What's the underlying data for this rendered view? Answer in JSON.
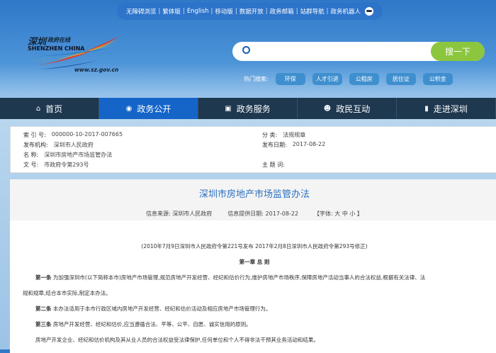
{
  "topbar": {
    "links": [
      "无障碍浏览",
      "繁体版",
      "English",
      "移动版",
      "数据开放",
      "政务邮箱",
      "站群导航",
      "政务机器人"
    ]
  },
  "logo": {
    "cn": "深圳",
    "cn_small": "政府在线",
    "en": "SHENZHEN CHINA",
    "url": "www.sz.gov.cn"
  },
  "search": {
    "placeholder": "",
    "button": "搜一下",
    "hot_label": "热门搜索:",
    "hot": [
      "环保",
      "人才引进",
      "公租房",
      "居住证",
      "公积金"
    ]
  },
  "nav": [
    {
      "label": "首页",
      "icon": "home-icon"
    },
    {
      "label": "政务公开",
      "icon": "news-icon"
    },
    {
      "label": "政务服务",
      "icon": "monitor-icon"
    },
    {
      "label": "政民互动",
      "icon": "people-icon"
    },
    {
      "label": "走进深圳",
      "icon": "building-icon"
    }
  ],
  "info": {
    "index_k": "索 引 号:",
    "index_v": "000000-10-2017-007665",
    "cat_k": "分 类:",
    "cat_v": "法规规章",
    "org_k": "发布机构:",
    "org_v": "深圳市人民政府",
    "date_k": "发布日期:",
    "date_v": "2017-08-22",
    "name_k": "名 称:",
    "name_v": "深圳市房地产市场监管办法",
    "doc_k": "文 号:",
    "doc_v": "市政府令第293号",
    "topic_k": "主 题 词:",
    "topic_v": ""
  },
  "article": {
    "title": "深圳市房地产市场监管办法",
    "source": "信息来源: 深圳市人民政府",
    "provided": "信息提供日期: 2017-08-22",
    "font": "【字体: 大 中 小 】",
    "note": "(2010年7月9日深圳市人民政府令第221号发布  2017年2月8日深圳市人民政府令第293号修正)",
    "chapter": "第一章 总 则",
    "a1_h": "第一条",
    "a1": "为加强深圳市(以下简称本市)房地产市场管理,规范房地产开发经营、经纪和估价行为,维护房地产市场秩序,保障房地产活动当事人的合法权益,根据有关法律、法",
    "a1b": "规和规章,结合本市实际,制定本办法。",
    "a2_h": "第二条",
    "a2": "本办法适用于本市行政区域内房地产开发经营、经纪和估价活动及相应房地产市场管理行为。",
    "a3_h": "第三条",
    "a3": "房地产开发经营、经纪和估价,应当遵循合法、平等、公平、自愿、诚实信用的原则。",
    "p4": "房地产开发企业、经纪和估价机构及其从业人员的合法权益受法律保护,任何单位和个人不得非法干预其业务活动和结果。"
  }
}
